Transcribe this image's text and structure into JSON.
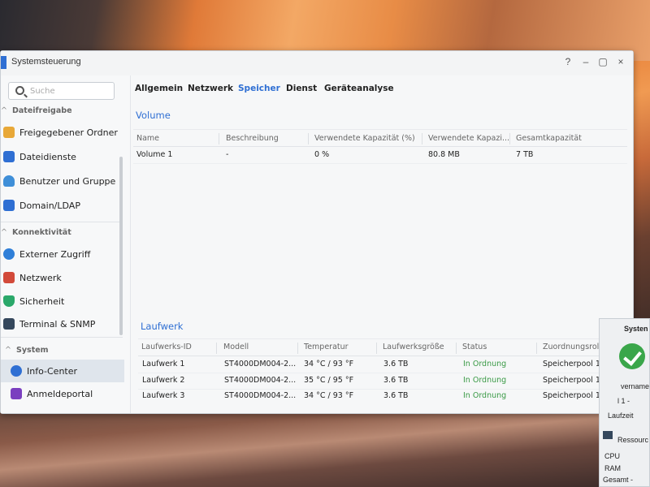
{
  "window": {
    "title": "Systemsteuerung",
    "controls": {
      "help": "?",
      "minimize": "–",
      "maximize": "▢",
      "close": "×"
    }
  },
  "sidebar": {
    "search_placeholder": "Suche",
    "sections": [
      {
        "label": "Dateifreigabe",
        "chevron": "^"
      },
      {
        "label": "Konnektivität",
        "chevron": "^"
      },
      {
        "label": "System",
        "chevron": "^"
      }
    ],
    "items": [
      {
        "label": "Freigegebener Ordner",
        "icon": "folder-icon",
        "color": "#e8a838"
      },
      {
        "label": "Dateidienste",
        "icon": "file-services-icon",
        "color": "#2f6fd3"
      },
      {
        "label": "Benutzer und Gruppe",
        "icon": "users-icon",
        "color": "#3f8fd8"
      },
      {
        "label": "Domain/LDAP",
        "icon": "domain-icon",
        "color": "#2f6fd3"
      },
      {
        "label": "Externer Zugriff",
        "icon": "external-access-icon",
        "color": "#2f7fd8"
      },
      {
        "label": "Netzwerk",
        "icon": "network-house-icon",
        "color": "#d24a3a"
      },
      {
        "label": "Sicherheit",
        "icon": "shield-icon",
        "color": "#2aa86a"
      },
      {
        "label": "Terminal & SNMP",
        "icon": "terminal-icon",
        "color": "#34475c"
      },
      {
        "label": "Info-Center",
        "icon": "info-icon",
        "color": "#2f6fd3"
      },
      {
        "label": "Anmeldeportal",
        "icon": "login-portal-icon",
        "color": "#7a3fbf"
      }
    ]
  },
  "tabs": [
    {
      "label": "Allgemein"
    },
    {
      "label": "Netzwerk"
    },
    {
      "label": "Speicher"
    },
    {
      "label": "Dienst"
    },
    {
      "label": "Geräteanalyse"
    }
  ],
  "volume": {
    "title": "Volume",
    "columns": [
      "Name",
      "Beschreibung",
      "Verwendete Kapazität (%)",
      "Verwendete Kapazi...",
      "Gesamtkapazität"
    ],
    "rows": [
      [
        "Volume 1",
        "-",
        "0 %",
        "80.8 MB",
        "7 TB"
      ]
    ]
  },
  "drives": {
    "title": "Laufwerk",
    "columns": [
      "Laufwerks-ID",
      "Modell",
      "Temperatur",
      "Laufwerksgröße",
      "Status",
      "Zuordnungsrolle"
    ],
    "rows": [
      [
        "Laufwerk 1",
        "ST4000DM004-2...",
        "34 °C / 93 °F",
        "3.6 TB",
        "In Ordnung",
        "Speicherpool 1"
      ],
      [
        "Laufwerk 2",
        "ST4000DM004-2...",
        "35 °C / 95 °F",
        "3.6 TB",
        "In Ordnung",
        "Speicherpool 1"
      ],
      [
        "Laufwerk 3",
        "ST4000DM004-2...",
        "34 °C / 93 °F",
        "3.6 TB",
        "In Ordnung",
        "Speicherpool 1"
      ]
    ]
  },
  "widget": {
    "title": "Systen",
    "line1": "vername",
    "line2": "l 1 -",
    "line3": "Laufzeit",
    "resources_title": "Ressourc",
    "cpu": "CPU",
    "ram": "RAM",
    "total": "Gesamt -"
  },
  "colors": {
    "accent": "#2f6fd3",
    "ok": "#3a9a46"
  }
}
